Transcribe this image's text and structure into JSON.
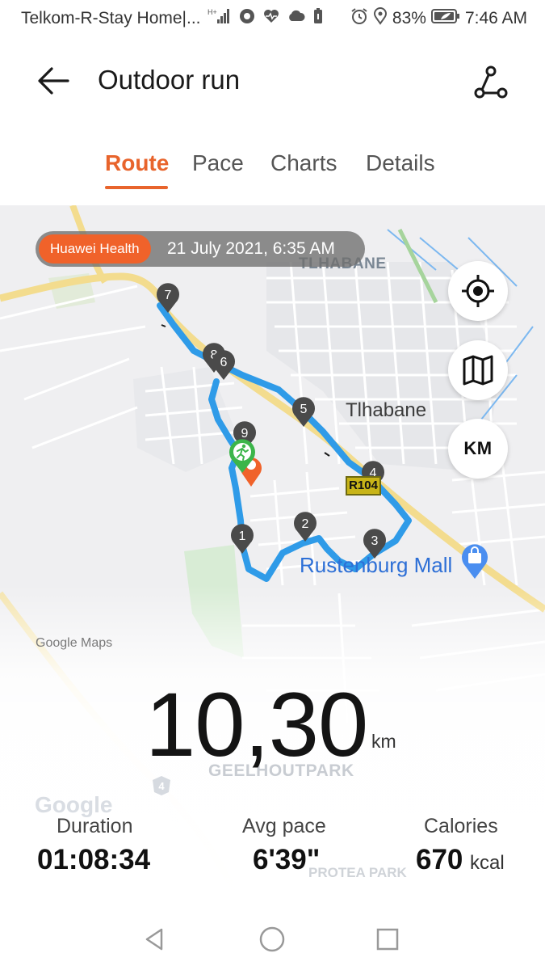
{
  "status_bar": {
    "carrier": "Telkom-R-Stay Home|...",
    "network_type": "H+",
    "battery_percent": "83%",
    "time": "7:46 AM",
    "icons": [
      "signal-icon",
      "record-icon",
      "heart-rate-icon",
      "cloud-icon",
      "battery-saver-icon",
      "alarm-icon",
      "location-icon",
      "battery-icon"
    ]
  },
  "app_bar": {
    "title": "Outdoor run",
    "back_icon": "arrow-left-icon",
    "share_icon": "share-route-icon"
  },
  "tabs": [
    {
      "label": "Route",
      "active": true
    },
    {
      "label": "Pace",
      "active": false
    },
    {
      "label": "Charts",
      "active": false
    },
    {
      "label": "Details",
      "active": false
    }
  ],
  "map": {
    "source_badge": "Huawei Health",
    "date": "21 July 2021, 6:35 AM",
    "buttons": {
      "locate_icon": "crosshair-icon",
      "map_type_icon": "map-icon",
      "unit_label": "KM"
    },
    "labels": {
      "area_caps": "TLHABANE",
      "area": "Tlhabane",
      "road_shield": "R104",
      "mall": "Rustenburg Mall",
      "attribution": "Google Maps",
      "suburb": "GEELHOUTPARK",
      "logo": "Google",
      "suburb_partial": "PROTEA PARK",
      "road_number": "4"
    },
    "km_markers": [
      "1",
      "2",
      "3",
      "4",
      "5",
      "6",
      "7",
      "8",
      "9"
    ],
    "route_color": "#2f9be8",
    "accent_color": "#e8642c"
  },
  "stats": {
    "distance_value": "10,30",
    "distance_unit": "km",
    "duration_label": "Duration",
    "duration_value": "01:08:34",
    "pace_label": "Avg pace",
    "pace_value": "6'39\"",
    "calories_label": "Calories",
    "calories_value": "670",
    "calories_unit": "kcal"
  },
  "nav_bar": {
    "icons": [
      "back-triangle-icon",
      "home-circle-icon",
      "recents-square-icon"
    ]
  }
}
